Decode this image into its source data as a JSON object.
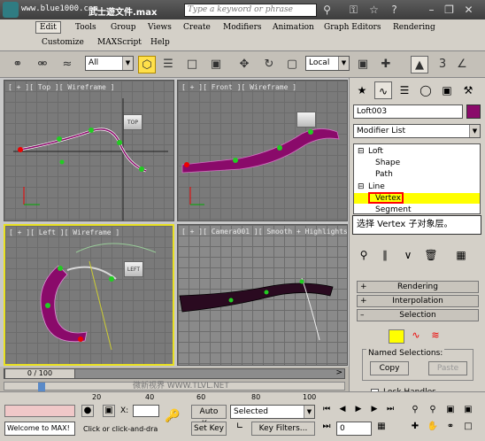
{
  "titlebar": {
    "site": "www.blue1000.com",
    "file_title": "武士遊文件.max",
    "search_placeholder": "Type a keyword or phrase"
  },
  "menu": {
    "items": [
      "Edit",
      "Tools",
      "Group",
      "Views",
      "Create",
      "Modifiers",
      "Animation",
      "Graph Editors",
      "Rendering",
      "Customize",
      "MAXScript",
      "Help"
    ]
  },
  "toolbar": {
    "selection_filter": "All",
    "ref_coord": "Local"
  },
  "viewports": [
    {
      "label": "[ + ][ Top ][ Wireframe ]",
      "cube": "TOP"
    },
    {
      "label": "[ + ][ Front ][ Wireframe ]",
      "cube": ""
    },
    {
      "label": "[ + ][ Left ][ Wireframe ]",
      "cube": "LEFT"
    },
    {
      "label": "[ + ][ Camera001 ][ Smooth + Highlights ]",
      "cube": ""
    }
  ],
  "command_panel": {
    "object_name": "Loft003",
    "modifier_list": "Modifier List",
    "stack": {
      "loft": "Loft",
      "shape": "Shape",
      "path": "Path",
      "line": "Line",
      "vertex": "Vertex",
      "segment": "Segment"
    },
    "rollouts": {
      "rendering": "Rendering",
      "interpolation": "Interpolation",
      "selection": "Selection"
    },
    "named_selections": "Named Selections:",
    "copy": "Copy",
    "paste": "Paste",
    "lock_handles": "Lock Handles"
  },
  "callout": "选择 Vertex 子对象层。",
  "timeline": {
    "frame_counter": "0 / 100",
    "ticks": [
      "0",
      "20",
      "40",
      "60",
      "80",
      "100"
    ]
  },
  "status": {
    "welcome": "Welcome to MAX!",
    "prompt": "Click or click-and-dra",
    "x_label": "X:",
    "auto_key": "Auto Key",
    "set_key": "Set Key",
    "key_mode": "Selected",
    "key_filters": "Key Filters...",
    "frame": "0"
  },
  "watermark": "微新视界 WWW.TLVL.NET",
  "colors": {
    "active_viewport": "#e8e020",
    "object_color": "#8a0a6a",
    "vertex_highlight": "#ffff00",
    "callout_border": "#ff0000"
  }
}
